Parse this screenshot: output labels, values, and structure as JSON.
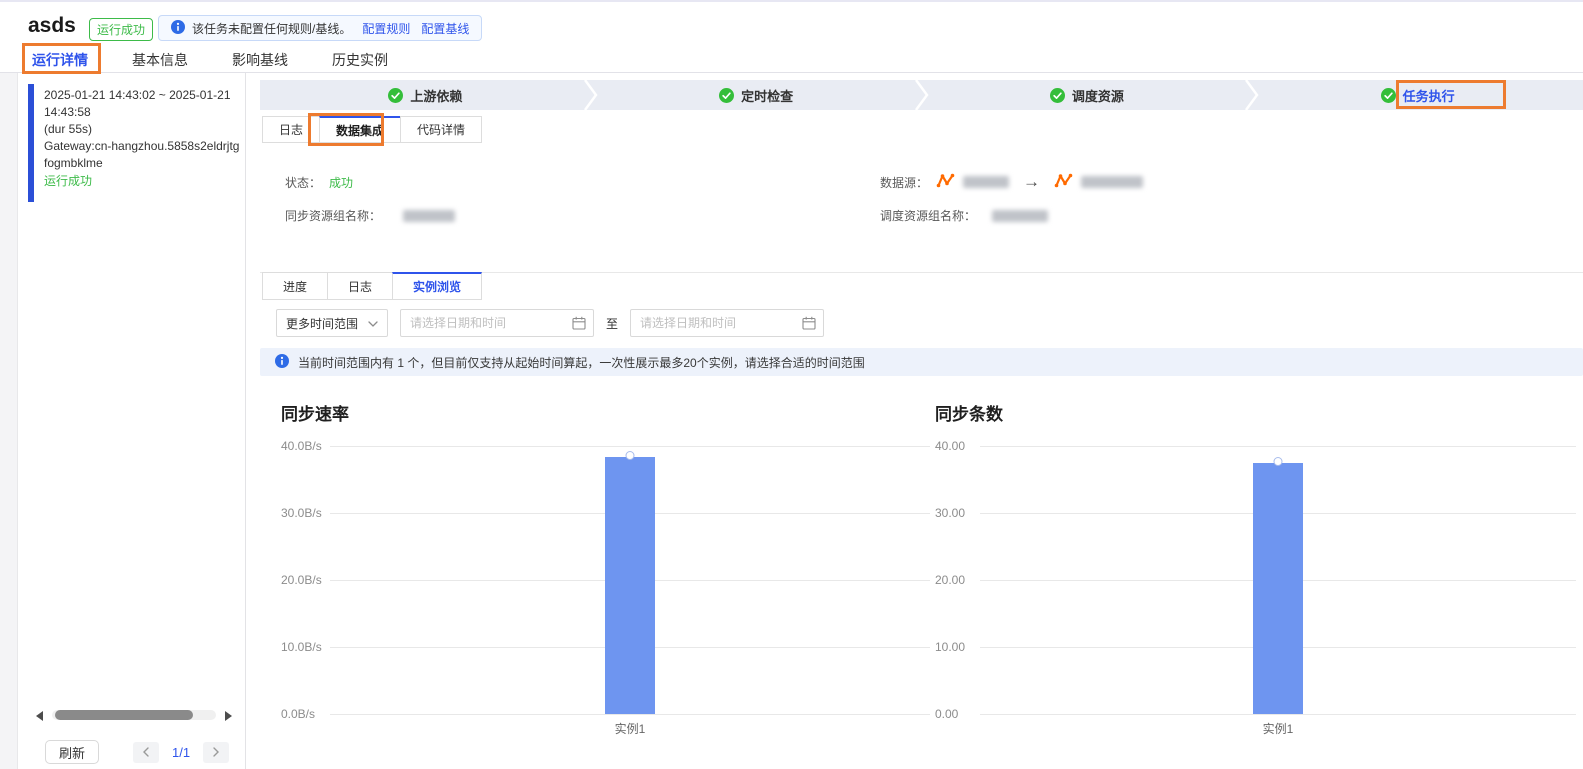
{
  "colors": {
    "primary_blue": "#2f54eb",
    "success_green": "#3dbb49",
    "check_green": "#34be3a",
    "annotation_orange": "#ed7b2f",
    "bar_blue": "#6e95f0",
    "datasource_orange": "#ff6a00",
    "banner_blue_bg": "#edf2fb"
  },
  "header": {
    "title": "asds",
    "status_badge": "运行成功",
    "notice_text": "该任务未配置任何规则/基线。",
    "notice_link1": "配置规则",
    "notice_link2": "配置基线",
    "tabs": [
      {
        "label": "运行详情"
      },
      {
        "label": "基本信息"
      },
      {
        "label": "影响基线"
      },
      {
        "label": "历史实例"
      }
    ]
  },
  "sidebar": {
    "instance": {
      "time_range": "2025-01-21 14:43:02 ~ 2025-01-21 14:43:58",
      "duration": "(dur 55s)",
      "gateway": "Gateway:cn-hangzhou.5858s2eldrjtgfogmbklme",
      "status": "运行成功"
    },
    "refresh_label": "刷新",
    "page_indicator": "1/1"
  },
  "steps": [
    {
      "label": "上游依赖",
      "state": "success"
    },
    {
      "label": "定时检查",
      "state": "success"
    },
    {
      "label": "调度资源",
      "state": "success"
    },
    {
      "label": "任务执行",
      "state": "success-active"
    }
  ],
  "detail_tabs": [
    {
      "label": "日志"
    },
    {
      "label": "数据集成"
    },
    {
      "label": "代码详情"
    }
  ],
  "integration": {
    "status_label": "状态：",
    "status_value": "成功",
    "sync_group_label": "同步资源组名称：",
    "datasource_label": "数据源：",
    "datasource_arrow": "→",
    "schedule_group_label": "调度资源组名称："
  },
  "instance_tabs": [
    {
      "label": "进度"
    },
    {
      "label": "日志"
    },
    {
      "label": "实例浏览"
    }
  ],
  "filters": {
    "range_dropdown_label": "更多时间范围",
    "start_placeholder": "请选择日期和时间",
    "to_label": "至",
    "end_placeholder": "请选择日期和时间"
  },
  "notice_banner": "当前时间范围内有 1 个，但目前仅支持从起始时间算起，一次性展示最多20个实例，请选择合适的时间范围",
  "chart_data": [
    {
      "type": "bar",
      "title": "同步速率",
      "categories": [
        "实例1"
      ],
      "values": [
        38.4
      ],
      "yticks": [
        "40.0B/s",
        "30.0B/s",
        "20.0B/s",
        "10.0B/s",
        "0.0B/s"
      ],
      "ylim": [
        0,
        40
      ],
      "grid": true,
      "legend": "none",
      "bar_color": "#6e95f0",
      "point_marker": true
    },
    {
      "type": "bar",
      "title": "同步条数",
      "categories": [
        "实例1"
      ],
      "values": [
        37.4
      ],
      "yticks": [
        "40.00",
        "30.00",
        "20.00",
        "10.00",
        "0.00"
      ],
      "ylim": [
        0,
        40
      ],
      "grid": true,
      "legend": "none",
      "bar_color": "#6e95f0",
      "point_marker": true
    }
  ]
}
